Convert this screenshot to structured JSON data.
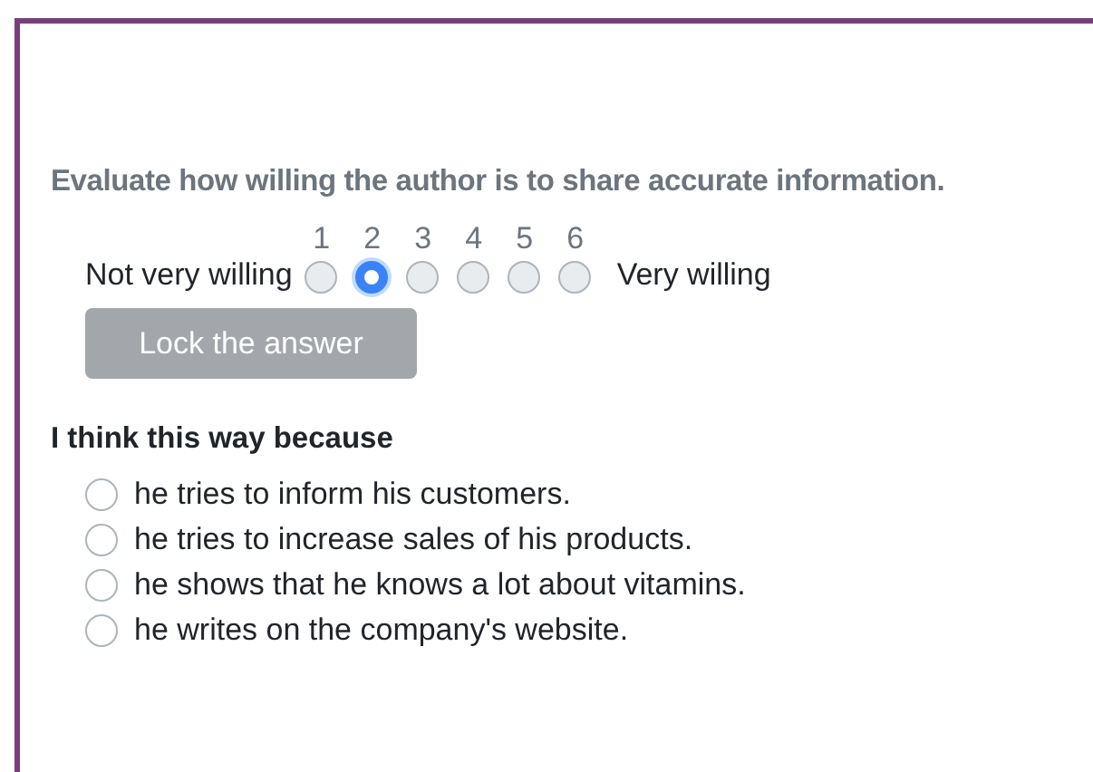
{
  "question": "Evaluate how willing the author is to share accurate information.",
  "scale": {
    "low_label": "Not very willing",
    "high_label": "Very willing",
    "points": [
      {
        "number": "1",
        "selected": false
      },
      {
        "number": "2",
        "selected": true
      },
      {
        "number": "3",
        "selected": false
      },
      {
        "number": "4",
        "selected": false
      },
      {
        "number": "5",
        "selected": false
      },
      {
        "number": "6",
        "selected": false
      }
    ]
  },
  "lock_button": {
    "label": "Lock the answer",
    "disabled": true
  },
  "reason_heading": "I think this way because",
  "reasons": [
    {
      "label": "he tries to inform his customers.",
      "selected": false
    },
    {
      "label": "he tries to increase sales of his products.",
      "selected": false
    },
    {
      "label": "he shows that he knows a lot about vitamins.",
      "selected": false
    },
    {
      "label": "he writes on the company's website.",
      "selected": false
    }
  ]
}
